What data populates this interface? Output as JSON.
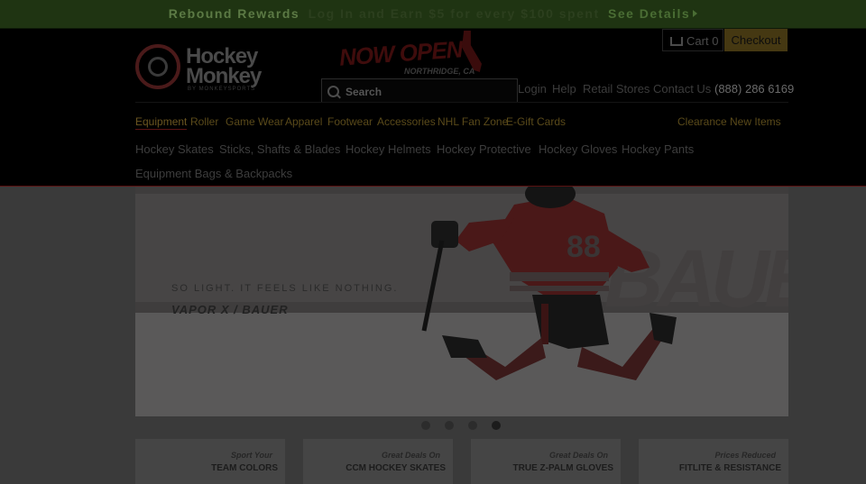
{
  "promo": {
    "text1": "Rebound Rewards",
    "text2": "Log In and Earn $5 for every $100 spent",
    "link": "See Details"
  },
  "header": {
    "logo_line1": "Hockey",
    "logo_line2": "Monkey",
    "logo_sub": "BY MONKEYSPORTS",
    "now_open": "NOW OPEN",
    "now_open_location": "NORTHRIDGE, CA",
    "search_placeholder": "Search",
    "cart_label": "Cart",
    "cart_count": "0",
    "checkout_label": "Checkout",
    "util_links": {
      "login": "Login",
      "help": "Help",
      "retail": "Retail Stores",
      "contact": "Contact Us",
      "phone": "(888) 286 6169"
    }
  },
  "menu": {
    "equipment": "Equipment",
    "roller": "Roller",
    "game_wear": "Game Wear",
    "apparel": "Apparel",
    "footwear": "Footwear",
    "accessories": "Accessories",
    "nhl": "NHL Fan Zone",
    "egift": "E-Gift Cards",
    "clearance": "Clearance",
    "new_items": "New Items"
  },
  "submenu": {
    "skates": "Hockey Skates",
    "sticks": "Sticks, Shafts & Blades",
    "helmets": "Hockey Helmets",
    "protective": "Hockey Protective",
    "gloves": "Hockey Gloves",
    "pants": "Hockey Pants",
    "bags": "Equipment Bags & Backpacks"
  },
  "hero": {
    "tagline": "SO LIGHT. IT FEELS LIKE NOTHING.",
    "brandline": "VAPOR  X  /  BAUER",
    "bg_word": "BAUER",
    "jersey_number": "88"
  },
  "slider": {
    "count": 4,
    "active_index": 4
  },
  "tiles": [
    {
      "top": "Sport Your",
      "main": "TEAM COLORS"
    },
    {
      "top": "Great Deals On",
      "main": "CCM HOCKEY SKATES"
    },
    {
      "top": "Great Deals On",
      "main": "TRUE Z-PALM GLOVES"
    },
    {
      "top": "Prices Reduced",
      "main": "FITLITE & RESISTANCE"
    }
  ]
}
